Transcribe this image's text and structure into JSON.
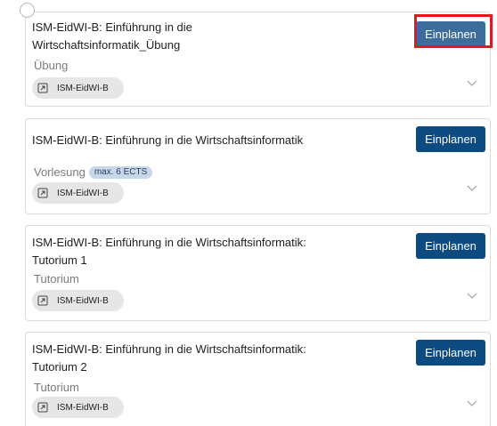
{
  "courses": [
    {
      "title": "ISM-EidWI-B: Einführung in die Wirtschaftsinformatik_Übung",
      "type": "Übung",
      "badge": "",
      "module": "ISM-EidWI-B",
      "button": "Einplanen"
    },
    {
      "title": "ISM-EidWI-B: Einführung in die Wirtschaftsinformatik",
      "type": "Vorlesung",
      "badge": "max. 6 ECTS",
      "module": "ISM-EidWI-B",
      "button": "Einplanen"
    },
    {
      "title": "ISM-EidWI-B: Einführung in die Wirtschaftsinformatik: Tutorium 1",
      "type": "Tutorium",
      "badge": "",
      "module": "ISM-EidWI-B",
      "button": "Einplanen"
    },
    {
      "title": "ISM-EidWI-B: Einführung in die Wirtschaftsinformatik: Tutorium 2",
      "type": "Tutorium",
      "badge": "",
      "module": "ISM-EidWI-B",
      "button": "Einplanen"
    }
  ],
  "icons": {
    "module": "external-link-icon",
    "expand": "chevron-down-icon",
    "select": "radio-circle-icon"
  },
  "colors": {
    "primary_button": "#0c4a80",
    "hovered_button": "#3c6c99",
    "highlight": "#e0191b",
    "badge": "#c8d8e8"
  }
}
